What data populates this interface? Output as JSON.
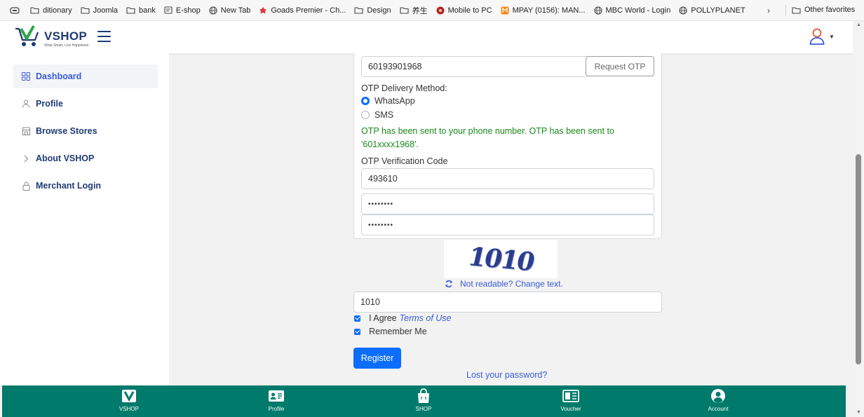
{
  "bookmarks": {
    "items": [
      {
        "label": "ditionary",
        "icon": "folder-icon"
      },
      {
        "label": "Joomla",
        "icon": "folder-icon"
      },
      {
        "label": "bank",
        "icon": "folder-icon"
      },
      {
        "label": "E-shop",
        "icon": "file-icon"
      },
      {
        "label": "New Tab",
        "icon": "globe-icon"
      },
      {
        "label": "Goads Premier - Ch...",
        "icon": "goads-icon"
      },
      {
        "label": "Design",
        "icon": "folder-icon"
      },
      {
        "label": "养生",
        "icon": "folder-icon"
      },
      {
        "label": "Mobile to PC",
        "icon": "mobile-to-pc-icon"
      },
      {
        "label": "MPAY (0156): MAN...",
        "icon": "mpay-icon"
      },
      {
        "label": "MBC World - Login",
        "icon": "globe-icon"
      },
      {
        "label": "POLLYPLANET",
        "icon": "globe-icon"
      }
    ],
    "other_favorites": "Other favorites"
  },
  "header": {
    "logo_title": "VSHOP",
    "logo_subtitle": "Shop Smart, Live Happiness"
  },
  "sidebar": {
    "items": [
      {
        "label": "Dashboard",
        "icon": "grid-icon",
        "active": true
      },
      {
        "label": "Profile",
        "icon": "user-icon",
        "active": false
      },
      {
        "label": "Browse Stores",
        "icon": "store-icon",
        "active": false
      },
      {
        "label": "About VSHOP",
        "icon": "chevron-right-icon",
        "active": false
      },
      {
        "label": "Merchant Login",
        "icon": "lock-icon",
        "active": false
      }
    ]
  },
  "form": {
    "phone_value": "60193901968",
    "request_otp_label": "Request OTP",
    "otp_method_label": "OTP Delivery Method:",
    "otp_methods": [
      {
        "label": "WhatsApp",
        "checked": true
      },
      {
        "label": "SMS",
        "checked": false
      }
    ],
    "otp_success_message": "OTP has been sent to your phone number. OTP has been sent to '601xxxx1968'.",
    "otp_code_label": "OTP Verification Code",
    "otp_code_value": "493610",
    "password_value": "••••••••",
    "confirm_password_value": "••••••••",
    "captcha_text": "1010",
    "captcha_refresh_label": "Not readable? Change text.",
    "captcha_input_value": "1010",
    "agree_label": "I Agree",
    "terms_link_label": "Terms of Use",
    "remember_label": "Remember Me",
    "register_label": "Register",
    "lost_password_label": "Lost your password?"
  },
  "bottom_nav": {
    "items": [
      {
        "label": "VSHOP",
        "icon": "vshop-logo-icon"
      },
      {
        "label": "Profile",
        "icon": "id-card-icon"
      },
      {
        "label": "SHOP",
        "icon": "shopping-bag-icon"
      },
      {
        "label": "Voucher",
        "icon": "voucher-icon"
      },
      {
        "label": "Account",
        "icon": "account-circle-icon"
      }
    ]
  },
  "colors": {
    "brand_navy": "#1f3b73",
    "link_blue": "#3a5bd9",
    "primary_button": "#0d6efd",
    "success_green": "#1a8a1a",
    "bottom_nav_teal": "#007a6b"
  }
}
